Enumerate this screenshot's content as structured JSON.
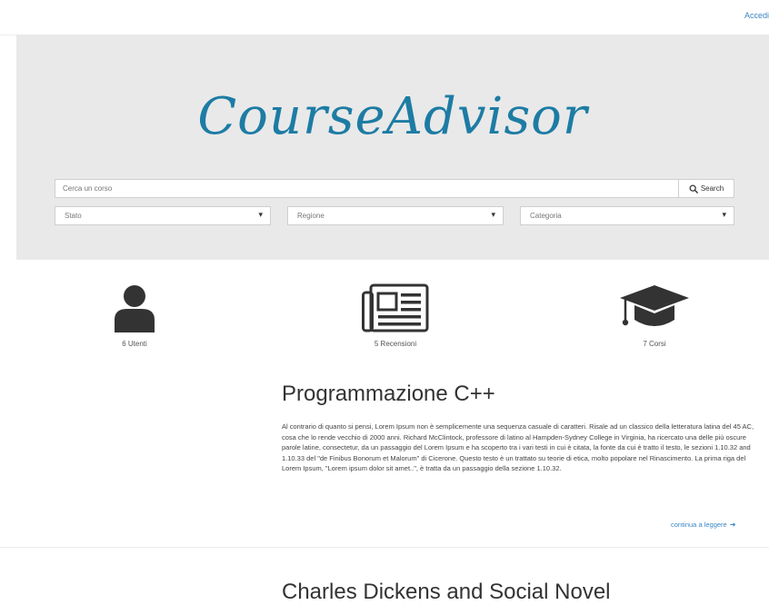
{
  "header": {
    "login_label": "Accedi"
  },
  "hero": {
    "logo_text": "CourseAdvisor",
    "search_placeholder": "Cerca un corso",
    "search_button_label": "Search",
    "filters": [
      {
        "label": "Stato"
      },
      {
        "label": "Regione"
      },
      {
        "label": "Categoria"
      }
    ]
  },
  "stats": [
    {
      "icon": "user-icon",
      "label": "6 Utenti"
    },
    {
      "icon": "newspaper-icon",
      "label": "5 Recensioni"
    },
    {
      "icon": "graduation-cap-icon",
      "label": "7 Corsi"
    }
  ],
  "articles": [
    {
      "title": "Programmazione C++",
      "body": "Al contrario di quanto si pensi, Lorem Ipsum non è semplicemente una sequenza casuale di caratteri. Risale ad un classico della letteratura latina del 45 AC, cosa che lo rende vecchio di 2000 anni. Richard McClintock, professore di latino al Hampden-Sydney College in Virginia, ha ricercato una delle più oscure parole latine, consectetur, da un passaggio del Lorem Ipsum e ha scoperto tra i vari testi in cui è citata, la fonte da cui è tratto il testo, le sezioni 1.10.32 and 1.10.33 del \"de Finibus Bonorum et Malorum\" di Cicerone. Questo testo è un trattato su teorie di etica, molto popolare nel Rinascimento. La prima riga del Lorem Ipsum, \"Lorem ipsum dolor sit amet..\", è tratta da un passaggio della sezione 1.10.32.",
      "continue_label": "continua a leggere"
    },
    {
      "title": "Charles Dickens and Social Novel"
    }
  ],
  "colors": {
    "accent": "#1d7ca4",
    "link": "#3a86c4",
    "hero_bg": "#e9e9e9"
  }
}
